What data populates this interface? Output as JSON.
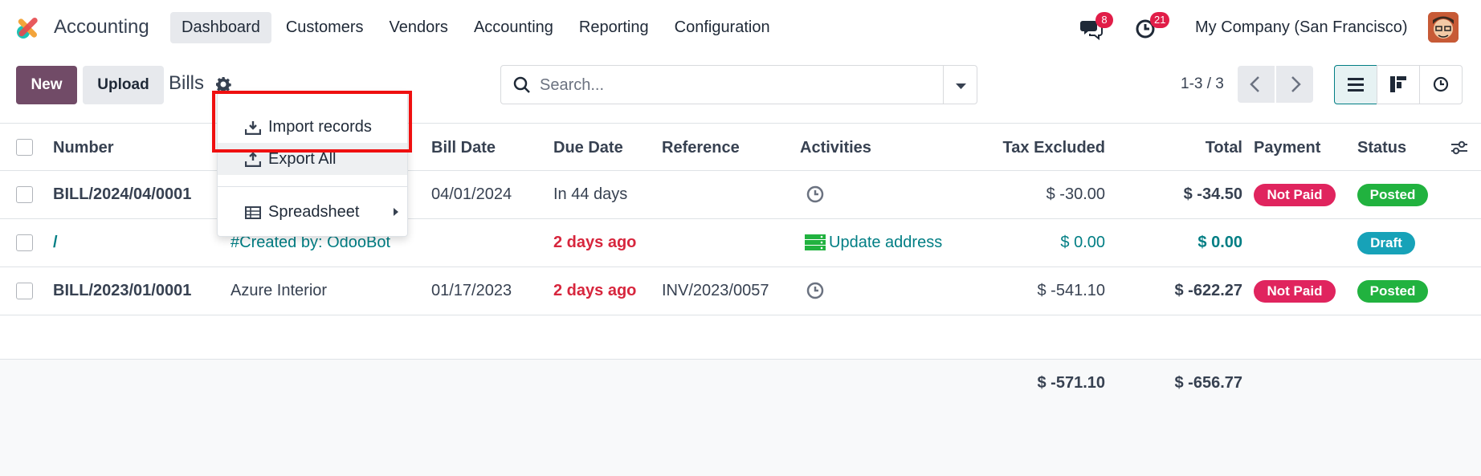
{
  "app": {
    "name": "Accounting"
  },
  "nav": {
    "items": [
      "Dashboard",
      "Customers",
      "Vendors",
      "Accounting",
      "Reporting",
      "Configuration"
    ],
    "active": "Dashboard",
    "messages_count": "8",
    "activities_count": "21",
    "company": "My Company (San Francisco)"
  },
  "control": {
    "new_label": "New",
    "upload_label": "Upload",
    "breadcrumb": "Bills",
    "search_placeholder": "Search...",
    "pager": "1-3 / 3"
  },
  "menu": {
    "import": "Import records",
    "export": "Export All",
    "spreadsheet": "Spreadsheet"
  },
  "table": {
    "headers": {
      "number": "Number",
      "bill_date": "Bill Date",
      "due_date": "Due Date",
      "reference": "Reference",
      "activities": "Activities",
      "tax_excluded": "Tax Excluded",
      "total": "Total",
      "payment": "Payment",
      "status": "Status"
    },
    "rows": [
      {
        "number": "BILL/2024/04/0001",
        "partner": "",
        "bill_date": "04/01/2024",
        "due_date": "In 44 days",
        "reference": "",
        "activity": "",
        "tax_excluded": "$ -30.00",
        "total": "$ -34.50",
        "payment": "Not Paid",
        "status": "Posted"
      },
      {
        "number": "/",
        "partner": "#Created by: OdooBot",
        "bill_date": "",
        "due_date": "2 days ago",
        "reference": "",
        "activity": "Update address",
        "tax_excluded": "$ 0.00",
        "total": "$ 0.00",
        "payment": "",
        "status": "Draft"
      },
      {
        "number": "BILL/2023/01/0001",
        "partner": "Azure Interior",
        "bill_date": "01/17/2023",
        "due_date": "2 days ago",
        "reference": "INV/2023/0057",
        "activity": "",
        "tax_excluded": "$ -541.10",
        "total": "$ -622.27",
        "payment": "Not Paid",
        "status": "Posted"
      }
    ],
    "totals": {
      "tax_excluded": "$ -571.10",
      "total": "$ -656.77"
    }
  },
  "colors": {
    "brand": "#714b67",
    "link": "#017e84",
    "not_paid": "#e0245e",
    "posted": "#21b23f",
    "draft": "#17a2b8",
    "overdue": "#d7263d",
    "highlight": "#ef1010"
  }
}
